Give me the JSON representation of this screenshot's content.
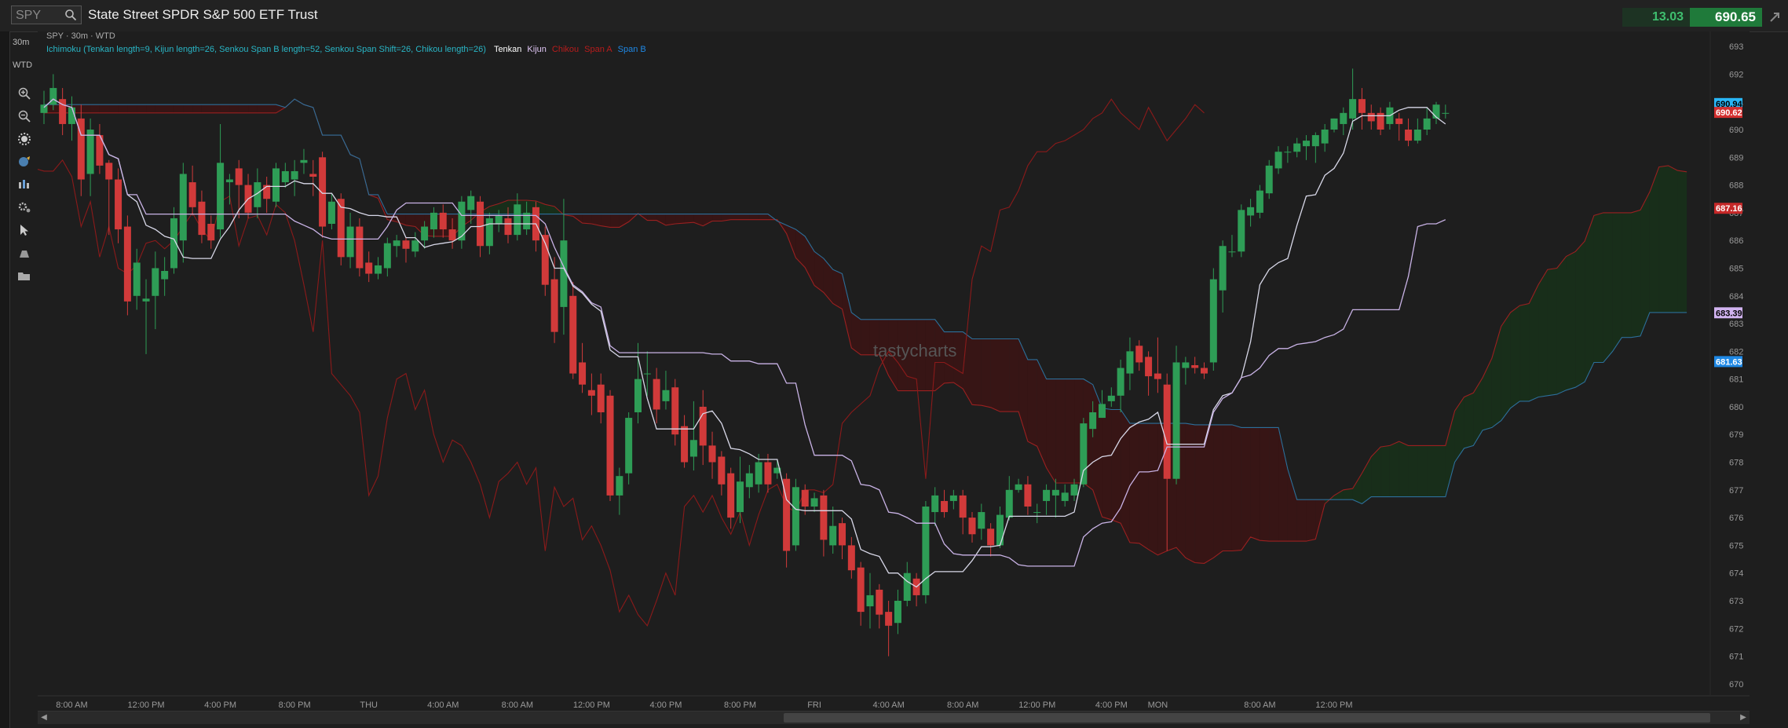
{
  "header": {
    "symbol": "SPY",
    "instrument_name": "State Street SPDR S&P 500 ETF Trust",
    "change": "13.03",
    "last_price": "690.65"
  },
  "toolbar": {
    "timeframe": "30m",
    "range": "WTD",
    "icons": [
      "zoom-in-icon",
      "zoom-out-icon",
      "settings-burst-icon",
      "globe-drawing-icon",
      "bar-style-icon",
      "gear-icon",
      "cursor-icon",
      "trendline-icon",
      "folder-icon"
    ]
  },
  "info": {
    "title": "SPY · 30m · WTD",
    "study": "Ichimoku (Tenkan length=9, Kijun length=26, Senkou Span B length=52, Senkou Span Shift=26, Chikou length=26)",
    "legend": [
      {
        "name": "Tenkan",
        "color": "#ffffff"
      },
      {
        "name": "Kijun",
        "color": "#e0c6f5"
      },
      {
        "name": "Chikou",
        "color": "#b71c1c"
      },
      {
        "name": "Span A",
        "color": "#b71c1c"
      },
      {
        "name": "Span B",
        "color": "#1e88e5"
      }
    ]
  },
  "watermark": "tastycharts",
  "colors": {
    "up": "#2e9d56",
    "down": "#d13a3a",
    "tenkan": "#d8d8e8",
    "kijun": "#c9b3e6",
    "chikou": "#8b1a1a",
    "spanA": "#9a2020",
    "spanB": "#2c6f9a",
    "cloud_bear": "#3a1414",
    "cloud_bull": "#17301a"
  },
  "chart_data": {
    "type": "candlestick",
    "ylim": [
      669.6,
      693.4
    ],
    "y_ticks": [
      670,
      671,
      672,
      673,
      674,
      675,
      676,
      677,
      678,
      679,
      680,
      681,
      682,
      683,
      684,
      685,
      686,
      687,
      688,
      689,
      690,
      691,
      692,
      693
    ],
    "x_ticks": [
      {
        "label": "8:00 AM",
        "i": 3
      },
      {
        "label": "12:00 PM",
        "i": 11
      },
      {
        "label": "4:00 PM",
        "i": 19
      },
      {
        "label": "8:00 PM",
        "i": 27
      },
      {
        "label": "THU",
        "i": 35
      },
      {
        "label": "4:00 AM",
        "i": 43
      },
      {
        "label": "8:00 AM",
        "i": 51
      },
      {
        "label": "12:00 PM",
        "i": 59
      },
      {
        "label": "4:00 PM",
        "i": 67
      },
      {
        "label": "8:00 PM",
        "i": 75
      },
      {
        "label": "FRI",
        "i": 83
      },
      {
        "label": "4:00 AM",
        "i": 91
      },
      {
        "label": "8:00 AM",
        "i": 99
      },
      {
        "label": "12:00 PM",
        "i": 107
      },
      {
        "label": "4:00 PM",
        "i": 115
      },
      {
        "label": "MON",
        "i": 120
      },
      {
        "label": "8:00 AM",
        "i": 131
      },
      {
        "label": "12:00 PM",
        "i": 139
      }
    ],
    "price_labels": [
      {
        "value": "690.94",
        "num": 690.94,
        "bg": "#29b6f6",
        "fg": "#000"
      },
      {
        "value": "690.62",
        "num": 690.62,
        "bg": "#d32f2f",
        "fg": "#fff"
      },
      {
        "value": "687.16",
        "num": 687.16,
        "bg": "#c62828",
        "fg": "#fff"
      },
      {
        "value": "683.39",
        "num": 683.39,
        "bg": "#d1b3f0",
        "fg": "#000"
      },
      {
        "value": "681.63",
        "num": 681.63,
        "bg": "#1e88e5",
        "fg": "#fff"
      }
    ],
    "candles": [
      [
        690.6,
        690.9,
        690.2,
        691.4
      ],
      [
        690.9,
        691.5,
        690.7,
        692.0
      ],
      [
        691.1,
        690.2,
        689.8,
        691.5
      ],
      [
        690.2,
        690.8,
        689.6,
        691.2
      ],
      [
        690.4,
        688.2,
        687.6,
        690.9
      ],
      [
        688.4,
        690.0,
        687.6,
        690.4
      ],
      [
        689.8,
        688.7,
        688.4,
        690.2
      ],
      [
        688.8,
        688.2,
        686.2,
        688.9
      ],
      [
        688.2,
        686.4,
        685.9,
        688.6
      ],
      [
        686.5,
        683.8,
        683.3,
        686.9
      ],
      [
        684.0,
        685.2,
        683.5,
        685.7
      ],
      [
        683.8,
        683.9,
        681.9,
        684.6
      ],
      [
        684.0,
        685.0,
        682.8,
        685.6
      ],
      [
        684.6,
        684.9,
        684.0,
        685.4
      ],
      [
        685.0,
        686.8,
        684.8,
        687.2
      ],
      [
        686.0,
        688.4,
        685.2,
        688.8
      ],
      [
        688.1,
        687.2,
        686.9,
        688.7
      ],
      [
        687.4,
        686.2,
        685.9,
        687.8
      ],
      [
        686.6,
        686.0,
        685.7,
        686.9
      ],
      [
        686.4,
        688.8,
        686.1,
        690.2
      ],
      [
        688.1,
        688.2,
        687.3,
        688.4
      ],
      [
        688.6,
        688.0,
        686.8,
        688.9
      ],
      [
        688.0,
        687.0,
        686.8,
        688.4
      ],
      [
        687.2,
        688.1,
        686.8,
        688.6
      ],
      [
        688.0,
        687.5,
        687.0,
        688.3
      ],
      [
        687.4,
        688.6,
        687.2,
        688.8
      ],
      [
        688.1,
        688.5,
        687.9,
        688.8
      ],
      [
        688.2,
        688.5,
        687.6,
        688.9
      ],
      [
        688.8,
        688.9,
        688.4,
        689.3
      ],
      [
        688.4,
        688.3,
        687.6,
        688.9
      ],
      [
        689.0,
        686.5,
        686.1,
        689.2
      ],
      [
        686.6,
        687.4,
        686.4,
        687.7
      ],
      [
        687.5,
        685.4,
        685.1,
        687.7
      ],
      [
        685.4,
        686.5,
        685.0,
        687.0
      ],
      [
        686.5,
        685.0,
        684.7,
        686.8
      ],
      [
        685.2,
        684.8,
        684.5,
        685.6
      ],
      [
        684.8,
        685.1,
        684.6,
        685.4
      ],
      [
        685.0,
        685.9,
        684.7,
        686.1
      ],
      [
        685.8,
        686.0,
        685.4,
        686.2
      ],
      [
        686.0,
        685.7,
        685.2,
        686.1
      ],
      [
        685.6,
        686.0,
        685.4,
        686.3
      ],
      [
        686.0,
        686.5,
        685.7,
        686.7
      ],
      [
        686.4,
        687.0,
        686.1,
        687.2
      ],
      [
        687.0,
        686.4,
        686.1,
        687.3
      ],
      [
        686.4,
        686.0,
        685.7,
        686.8
      ],
      [
        686.0,
        687.4,
        685.7,
        687.6
      ],
      [
        687.1,
        687.6,
        686.6,
        687.8
      ],
      [
        687.4,
        685.8,
        685.4,
        687.6
      ],
      [
        685.8,
        686.8,
        685.5,
        687.0
      ],
      [
        686.6,
        686.9,
        686.3,
        687.1
      ],
      [
        686.8,
        686.2,
        685.9,
        687.2
      ],
      [
        686.2,
        687.3,
        686.0,
        687.7
      ],
      [
        686.4,
        687.0,
        686.2,
        687.4
      ],
      [
        687.2,
        686.0,
        685.6,
        687.4
      ],
      [
        686.2,
        684.4,
        684.0,
        686.5
      ],
      [
        684.6,
        682.7,
        682.3,
        685.4
      ],
      [
        683.6,
        686.0,
        682.6,
        687.5
      ],
      [
        684.0,
        681.2,
        681.0,
        684.5
      ],
      [
        681.6,
        680.8,
        680.5,
        682.3
      ],
      [
        680.6,
        680.4,
        679.7,
        681.2
      ],
      [
        680.8,
        679.8,
        679.4,
        681.2
      ],
      [
        680.4,
        676.8,
        676.6,
        680.6
      ],
      [
        676.8,
        677.5,
        676.1,
        677.8
      ],
      [
        677.6,
        679.6,
        677.2,
        679.8
      ],
      [
        679.8,
        681.0,
        679.4,
        682.3
      ],
      [
        681.2,
        681.2,
        680.4,
        682.0
      ],
      [
        681.0,
        679.9,
        679.4,
        681.4
      ],
      [
        680.2,
        680.6,
        679.9,
        681.3
      ],
      [
        680.7,
        679.0,
        678.6,
        681.0
      ],
      [
        679.3,
        678.0,
        677.8,
        679.7
      ],
      [
        678.2,
        678.8,
        677.7,
        680.2
      ],
      [
        680.0,
        678.6,
        677.9,
        680.6
      ],
      [
        678.6,
        678.0,
        677.4,
        679.1
      ],
      [
        678.2,
        677.2,
        676.8,
        678.4
      ],
      [
        677.6,
        676.0,
        675.6,
        677.8
      ],
      [
        676.2,
        677.3,
        675.8,
        678.2
      ],
      [
        677.1,
        677.6,
        676.7,
        677.9
      ],
      [
        677.2,
        678.0,
        676.9,
        678.3
      ],
      [
        678.0,
        677.2,
        676.9,
        678.3
      ],
      [
        677.6,
        677.8,
        677.4,
        678.1
      ]
    ],
    "note": "candles: [open, close, low, high] per 30m bar; last bars continue to the right in script",
    "tail_candles": [
      [
        677.4,
        674.8,
        674.2,
        677.6
      ],
      [
        675.0,
        677.1,
        674.8,
        677.4
      ],
      [
        677.0,
        676.4,
        676.1,
        677.2
      ],
      [
        676.4,
        676.7,
        676.2,
        676.9
      ],
      [
        676.8,
        675.2,
        674.6,
        677.0
      ],
      [
        675.0,
        675.7,
        674.7,
        676.4
      ],
      [
        675.8,
        675.0,
        674.5,
        676.0
      ],
      [
        675.0,
        674.1,
        673.8,
        675.3
      ],
      [
        674.2,
        672.6,
        672.1,
        674.4
      ],
      [
        672.8,
        673.2,
        672.0,
        674.0
      ],
      [
        673.4,
        672.5,
        672.0,
        673.6
      ],
      [
        672.6,
        672.1,
        671.0,
        673.0
      ],
      [
        672.2,
        673.0,
        671.8,
        673.4
      ],
      [
        673.0,
        674.0,
        672.8,
        674.4
      ],
      [
        673.8,
        673.2,
        672.8,
        674.0
      ],
      [
        673.2,
        676.4,
        672.9,
        676.6
      ],
      [
        676.2,
        676.8,
        675.7,
        677.1
      ],
      [
        676.6,
        676.2,
        676.0,
        677.0
      ],
      [
        676.6,
        676.8,
        676.3,
        677.0
      ],
      [
        676.8,
        676.0,
        675.4,
        677.0
      ],
      [
        676.0,
        675.4,
        675.1,
        676.2
      ],
      [
        675.6,
        676.2,
        675.2,
        676.5
      ],
      [
        675.6,
        675.0,
        674.6,
        675.8
      ],
      [
        675.0,
        676.1,
        674.9,
        676.4
      ],
      [
        676.0,
        677.0,
        675.9,
        677.5
      ],
      [
        677.0,
        677.2,
        676.9,
        677.4
      ],
      [
        677.2,
        676.4,
        676.1,
        677.5
      ],
      [
        676.2,
        676.2,
        675.8,
        676.5
      ],
      [
        676.6,
        677.0,
        676.1,
        677.2
      ],
      [
        676.8,
        677.0,
        676.0,
        677.4
      ],
      [
        676.6,
        676.9,
        676.4,
        677.2
      ],
      [
        676.8,
        677.2,
        676.6,
        677.4
      ],
      [
        677.2,
        679.4,
        677.1,
        679.6
      ],
      [
        679.2,
        679.8,
        678.9,
        680.2
      ],
      [
        679.6,
        680.1,
        679.6,
        680.6
      ],
      [
        680.2,
        680.4,
        680.0,
        680.7
      ],
      [
        680.4,
        681.4,
        679.8,
        681.7
      ],
      [
        681.2,
        682.0,
        680.6,
        682.5
      ],
      [
        682.2,
        681.6,
        681.3,
        682.4
      ],
      [
        681.8,
        681.1,
        680.4,
        682.0
      ],
      [
        681.2,
        681.0,
        680.5,
        682.5
      ],
      [
        680.8,
        677.4,
        674.8,
        681.2
      ],
      [
        677.4,
        681.6,
        677.2,
        682.2
      ],
      [
        681.4,
        681.6,
        680.8,
        681.8
      ],
      [
        681.5,
        681.4,
        681.2,
        681.8
      ],
      [
        681.4,
        681.2,
        681.0,
        681.6
      ],
      [
        681.6,
        684.6,
        681.3,
        685.0
      ],
      [
        684.2,
        685.8,
        683.4,
        686.0
      ],
      [
        685.6,
        685.6,
        685.4,
        686.2
      ],
      [
        685.6,
        687.1,
        685.4,
        687.3
      ],
      [
        686.9,
        687.2,
        686.5,
        687.5
      ],
      [
        687.0,
        687.8,
        686.8,
        688.0
      ],
      [
        687.7,
        688.7,
        687.5,
        688.9
      ],
      [
        688.6,
        689.2,
        688.4,
        689.4
      ],
      [
        689.2,
        689.2,
        688.8,
        689.4
      ],
      [
        689.2,
        689.5,
        689.0,
        689.7
      ],
      [
        689.4,
        689.6,
        688.9,
        689.8
      ],
      [
        689.4,
        689.8,
        688.8,
        689.9
      ],
      [
        689.5,
        690.0,
        689.2,
        690.2
      ],
      [
        690.0,
        690.4,
        689.9,
        690.4
      ],
      [
        690.2,
        690.6,
        689.8,
        690.8
      ],
      [
        690.4,
        691.1,
        690.0,
        692.2
      ],
      [
        691.1,
        690.6,
        690.0,
        691.5
      ],
      [
        690.6,
        690.3,
        690.0,
        690.9
      ],
      [
        690.6,
        690.0,
        689.8,
        690.8
      ],
      [
        690.2,
        690.8,
        690.0,
        691.0
      ],
      [
        690.4,
        690.2,
        689.6,
        690.6
      ],
      [
        690.0,
        689.6,
        689.4,
        690.4
      ],
      [
        689.6,
        690.0,
        689.5,
        690.4
      ],
      [
        690.0,
        690.4,
        689.8,
        690.8
      ],
      [
        690.4,
        690.9,
        690.2,
        691.0
      ],
      [
        690.6,
        690.6,
        690.4,
        690.9
      ]
    ]
  }
}
